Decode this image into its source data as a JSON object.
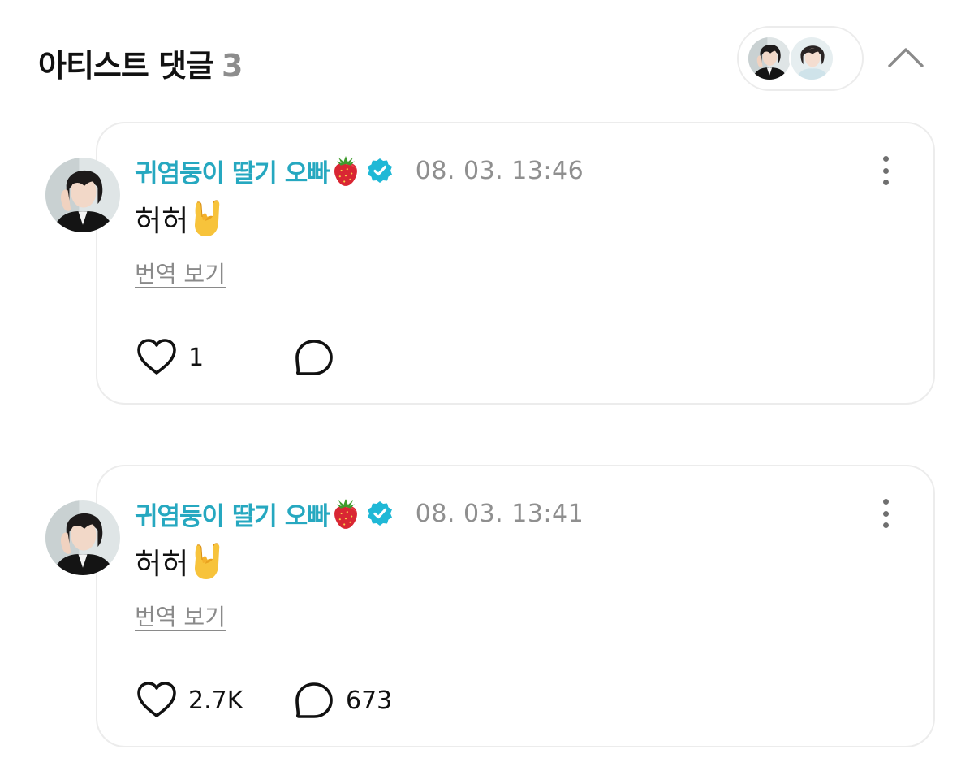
{
  "header": {
    "title": "아티스트 댓글",
    "count": "3"
  },
  "colors": {
    "accent": "#26a8c0",
    "muted": "#8f8f8f",
    "border": "#ececec",
    "verified": "#1fb8d6"
  },
  "icons": {
    "collapse": "chevron-up-icon",
    "verified": "verified-badge-icon",
    "more": "kebab-menu-icon",
    "like": "heart-outline-icon",
    "reply": "speech-bubble-icon",
    "emoji_author": "strawberry-emoji",
    "emoji_comment": "rock-on-hand-emoji"
  },
  "comments": [
    {
      "author": "귀염둥이 딸기 오빠",
      "timestamp": "08. 03. 13:46",
      "text": "허허",
      "translate_label": "번역 보기",
      "likes": "1",
      "replies": ""
    },
    {
      "author": "귀염둥이 딸기 오빠",
      "timestamp": "08. 03. 13:41",
      "text": "허허",
      "translate_label": "번역 보기",
      "likes": "2.7K",
      "replies": "673"
    }
  ]
}
